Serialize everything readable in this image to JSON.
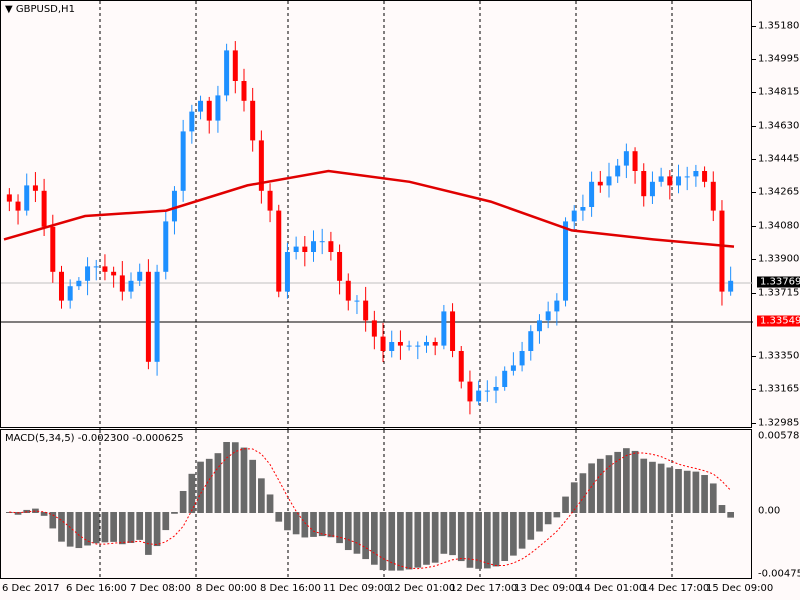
{
  "symbol_title": "GBPUSD,H1",
  "macd_title": "MACD(5,34,5) -0.002300 -0.000625",
  "colors": {
    "bull": "#1e90ff",
    "bear": "#ff0000",
    "ma": "#e00000",
    "hist": "#696969",
    "signal": "#ff0000",
    "bid_tag": "#000000",
    "line_tag": "#ff0000"
  },
  "price_axis": [
    "1.35180",
    "1.34995",
    "1.34815",
    "1.34630",
    "1.34445",
    "1.34265",
    "1.34080",
    "1.33900",
    "1.33715",
    "1.33350",
    "1.33165",
    "1.32985"
  ],
  "current_price": "1.33769",
  "level_price": "1.33549",
  "macd_axis": {
    "top": "0.00578",
    "zero": "0.00",
    "bottom": "-0.004756"
  },
  "time_axis": [
    "6 Dec 2017",
    "6 Dec 16:00",
    "7 Dec 08:00",
    "8 Dec 00:00",
    "8 Dec 16:00",
    "11 Dec 09:00",
    "12 Dec 01:00",
    "12 Dec 17:00",
    "13 Dec 09:00",
    "14 Dec 01:00",
    "14 Dec 17:00",
    "15 Dec 09:00"
  ],
  "chart_data": {
    "type": "candlestick",
    "ylim": [
      1.32985,
      1.3518
    ],
    "closes": [
      1.3421,
      1.3416,
      1.343,
      1.3427,
      1.3407,
      1.3382,
      1.3366,
      1.3374,
      1.3377,
      1.3385,
      1.3385,
      1.3382,
      1.338,
      1.3371,
      1.3377,
      1.3382,
      1.3332,
      1.3382,
      1.341,
      1.3427,
      1.346,
      1.3471,
      1.3477,
      1.3466,
      1.348,
      1.3505,
      1.3488,
      1.3477,
      1.3455,
      1.3427,
      1.3416,
      1.3371,
      1.3393,
      1.3396,
      1.3393,
      1.3399,
      1.3399,
      1.3393,
      1.3377,
      1.3366,
      1.3366,
      1.3355,
      1.3346,
      1.3338,
      1.3343,
      1.3341,
      1.3341,
      1.3341,
      1.3343,
      1.3341,
      1.336,
      1.3338,
      1.3321,
      1.331,
      1.3316,
      1.3316,
      1.3318,
      1.3327,
      1.333,
      1.3338,
      1.3349,
      1.3355,
      1.336,
      1.3366,
      1.341,
      1.3416,
      1.3418,
      1.3432,
      1.343,
      1.3435,
      1.3441,
      1.3449,
      1.3438,
      1.3424,
      1.3432,
      1.3435,
      1.343,
      1.3435,
      1.3435,
      1.3438,
      1.3432,
      1.3416,
      1.3371,
      1.3377
    ],
    "ma": [
      1.34,
      1.3413,
      1.3416,
      1.343,
      1.3438,
      1.3432,
      1.3421,
      1.3405,
      1.34,
      1.3396
    ]
  }
}
